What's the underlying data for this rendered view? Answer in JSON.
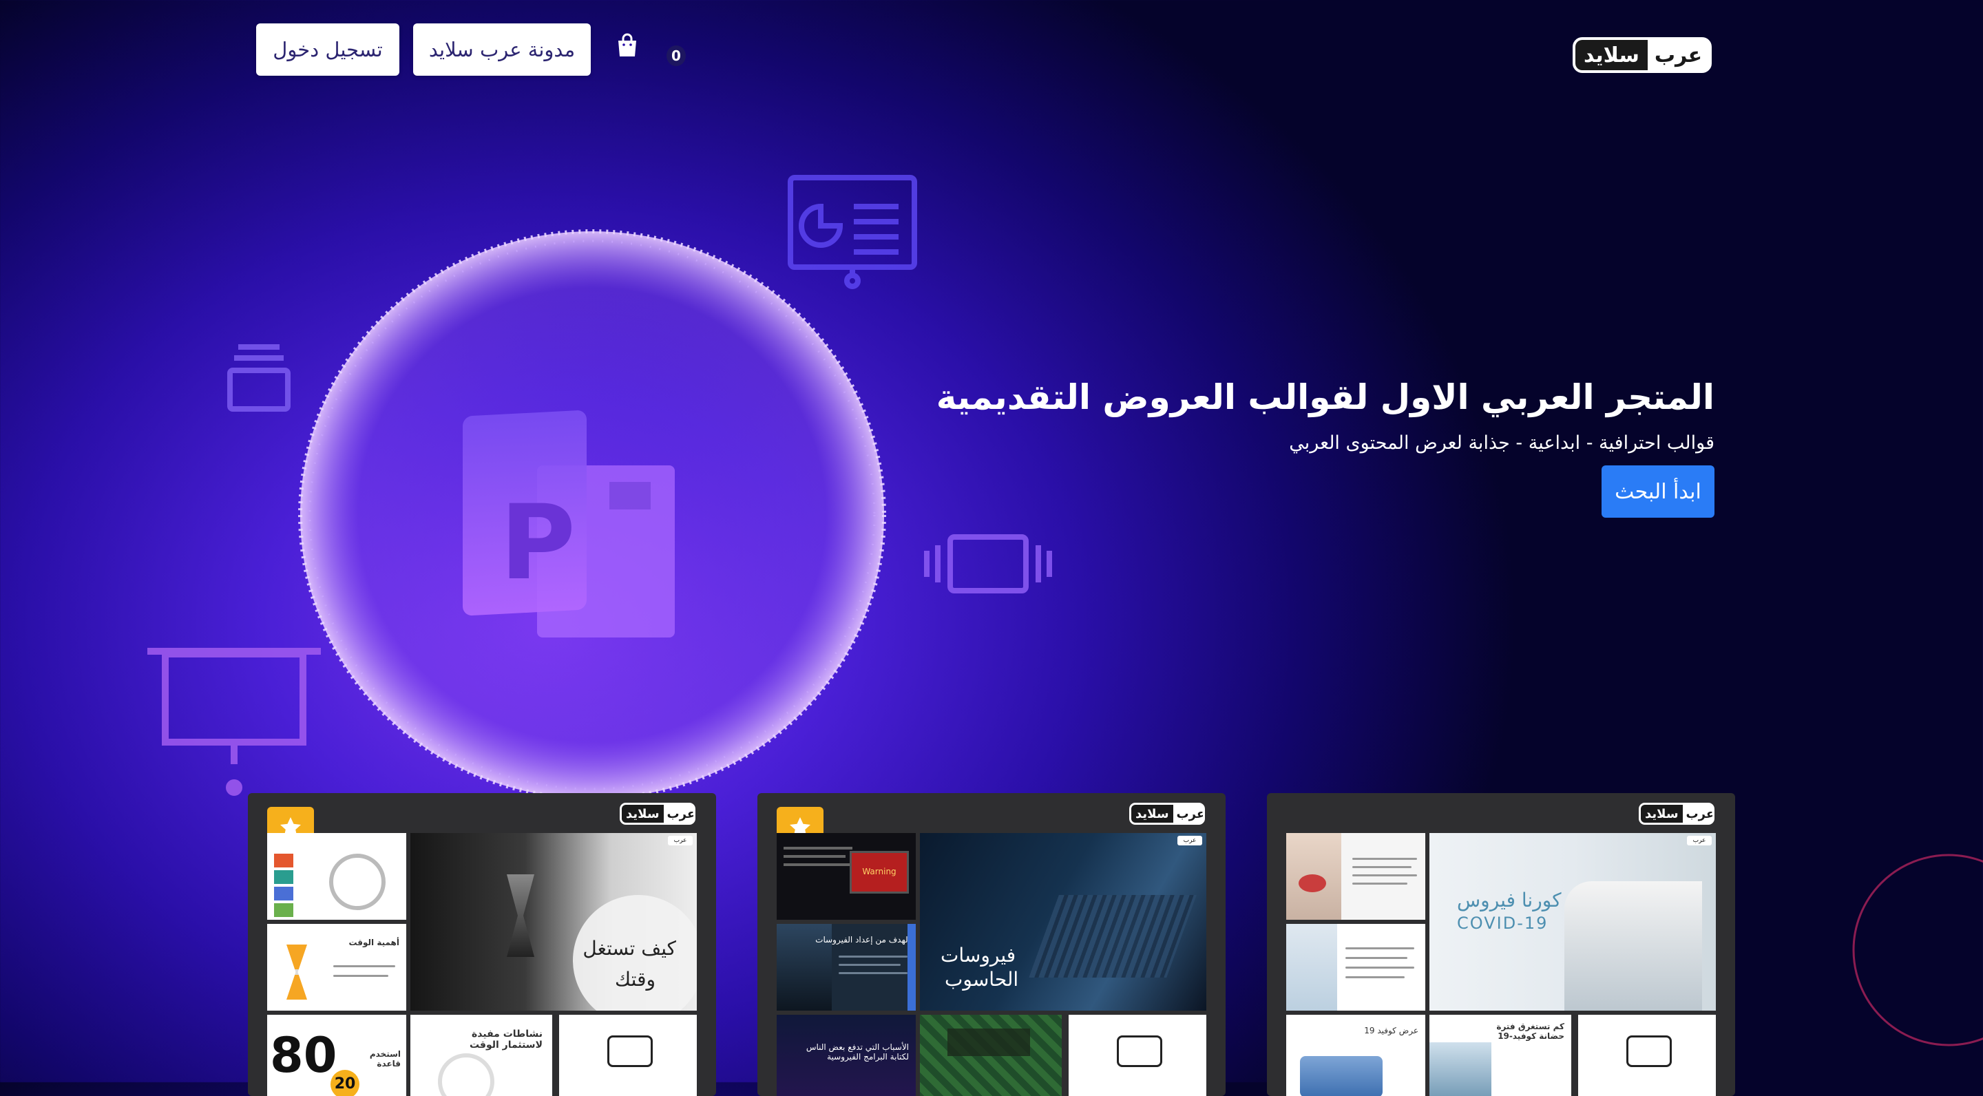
{
  "header": {
    "logo_word_a": "عرب",
    "logo_word_b": "سلايد",
    "login_label": "تسجيل دخول",
    "blog_label": "مدونة عرب سلايد",
    "cart_count": "0",
    "cart_icon": "shopping-bag-icon"
  },
  "hero": {
    "title": "المتجر العربي الاول لقوالب العروض التقديمية",
    "subtitle": "قوالب احترافية - ابداعية - جذابة لعرض المحتوى العربي",
    "cta_label": "ابدأ البحث"
  },
  "cards": [
    {
      "featured": true,
      "big_text_line1": "كيف تستغل",
      "big_text_line2": "وقتك",
      "thumb_labels": [
        "أهمية الوقت",
        "نشاطات مفيدة لاستثمار الوقت",
        "استخدم قاعدة",
        "80",
        "20"
      ]
    },
    {
      "featured": true,
      "big_text_line1": "فيروسات",
      "big_text_line2": "الحاسوب",
      "thumb_labels": [
        "الهدف من إعداد الفيروسات",
        "الأسباب التي تدفع بعض الناس لكتابة البرامج الفيروسية",
        "Warning"
      ]
    },
    {
      "featured": false,
      "big_text_line1": "كورنا فيروس",
      "big_text_line2": "COVID-19",
      "thumb_labels": [
        "كم تستغرق فترة حضانة كوفيد-19",
        "عرض كوفيد 19"
      ]
    }
  ],
  "colors": {
    "accent_button": "#2a7cf6",
    "star_badge": "#f6b01c",
    "card_bg": "#2e2e30"
  }
}
